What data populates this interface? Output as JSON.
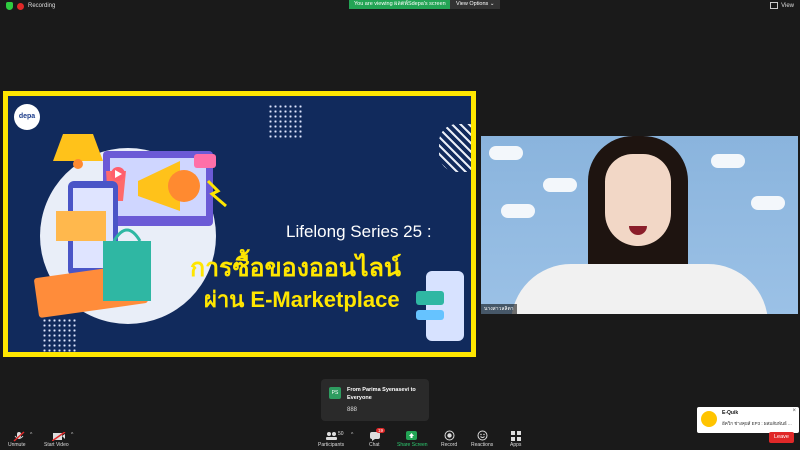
{
  "topbar": {
    "recording_label": "Recording",
    "viewing_banner": "You are viewing ผลตพ์Sdepa's screen",
    "view_options": "View Options",
    "view_label": "View"
  },
  "slide": {
    "logo": "depa",
    "title_line1": "Lifelong Series 25 :",
    "title_line2": "การซื้อของออนไลน์",
    "title_line3": "ผ่าน E-Marketplace"
  },
  "webcam": {
    "name_label": "นางสาวลลิตา"
  },
  "chat_popup": {
    "avatar_initials": "PS",
    "from": "From Parima Syenasevi to Everyone",
    "message": "888"
  },
  "notification": {
    "title": "E-Quik",
    "body": "อีควิก ช่างคุยส์ EP3 : ผสมสัมพันธ์ ..."
  },
  "toolbar": {
    "unmute": "Unmute",
    "start_video": "Start Video",
    "participants": "Participants",
    "participants_count": "50",
    "chat": "Chat",
    "chat_badge": "19",
    "share_screen": "Share Screen",
    "record": "Record",
    "reactions": "Reactions",
    "apps": "Apps",
    "leave": "Leave"
  },
  "colors": {
    "slide_border": "#ffe600",
    "slide_bg": "#112a5c",
    "share_green": "#23a455",
    "leave_red": "#e02828"
  }
}
